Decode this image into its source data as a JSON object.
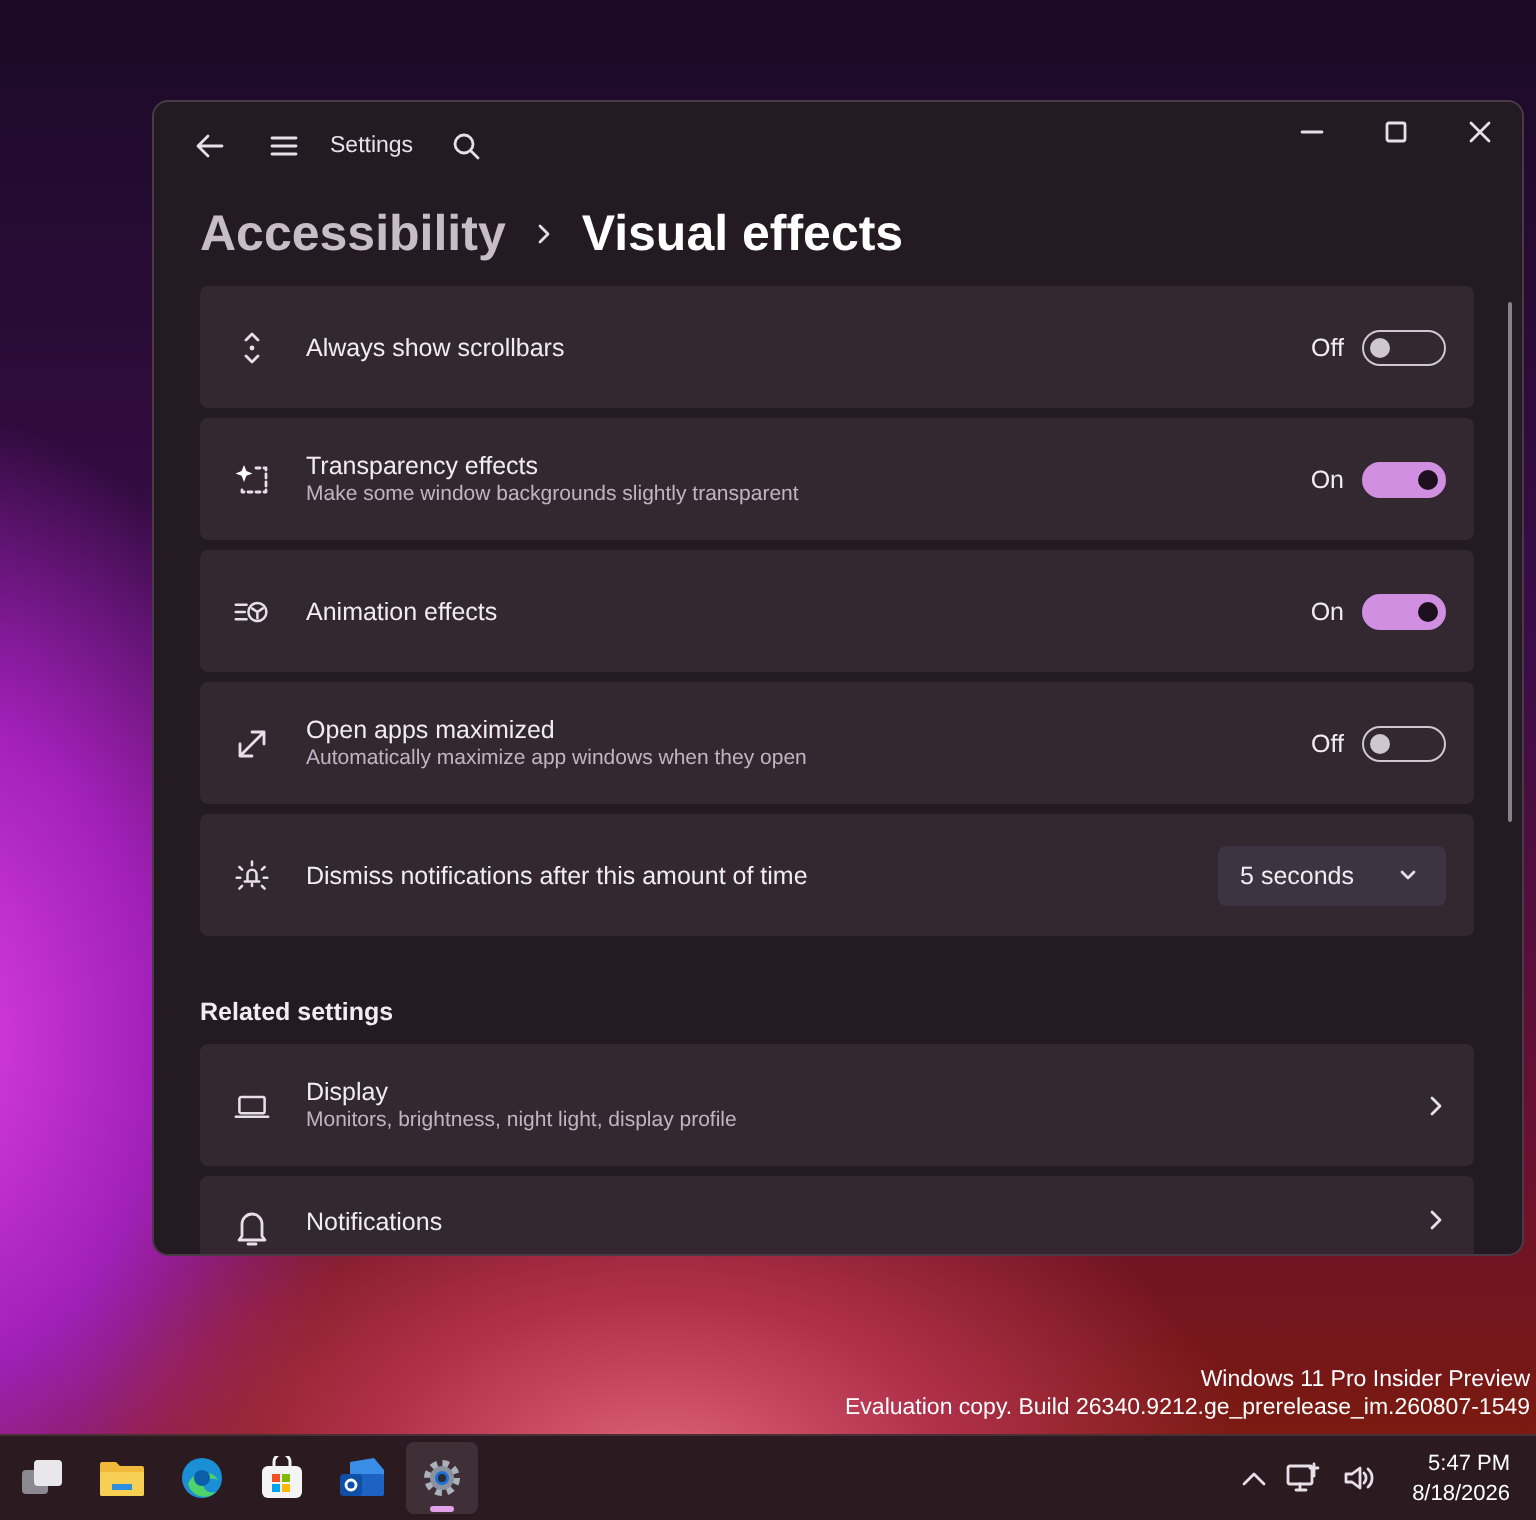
{
  "window": {
    "title": "Settings"
  },
  "breadcrumb": {
    "parent": "Accessibility",
    "current": "Visual effects"
  },
  "settings": [
    {
      "kind": "toggle",
      "title": "Always show scrollbars",
      "state_label": "Off",
      "on": false
    },
    {
      "kind": "toggle",
      "title": "Transparency effects",
      "description": "Make some window backgrounds slightly transparent",
      "state_label": "On",
      "on": true
    },
    {
      "kind": "toggle",
      "title": "Animation effects",
      "state_label": "On",
      "on": true
    },
    {
      "kind": "toggle",
      "title": "Open apps maximized",
      "description": "Automatically maximize app windows when they open",
      "state_label": "Off",
      "on": false
    },
    {
      "kind": "dropdown",
      "title": "Dismiss notifications after this amount of time",
      "value": "5 seconds"
    }
  ],
  "related": {
    "heading": "Related settings",
    "items": [
      {
        "title": "Display",
        "description": "Monitors, brightness, night light, display profile"
      },
      {
        "title": "Notifications"
      }
    ]
  },
  "desktop_text": [
    "Windows 11 Pro Insider Preview",
    "Evaluation copy. Build 26340.9212.ge_prerelease_im.260807-1549"
  ],
  "taskbar": {
    "apps": [
      {
        "selected": false
      },
      {
        "selected": false
      },
      {
        "selected": false
      },
      {
        "selected": false
      },
      {
        "selected": false
      },
      {
        "selected": true
      }
    ],
    "time": "5:47 PM",
    "date": "8/18/2026"
  }
}
